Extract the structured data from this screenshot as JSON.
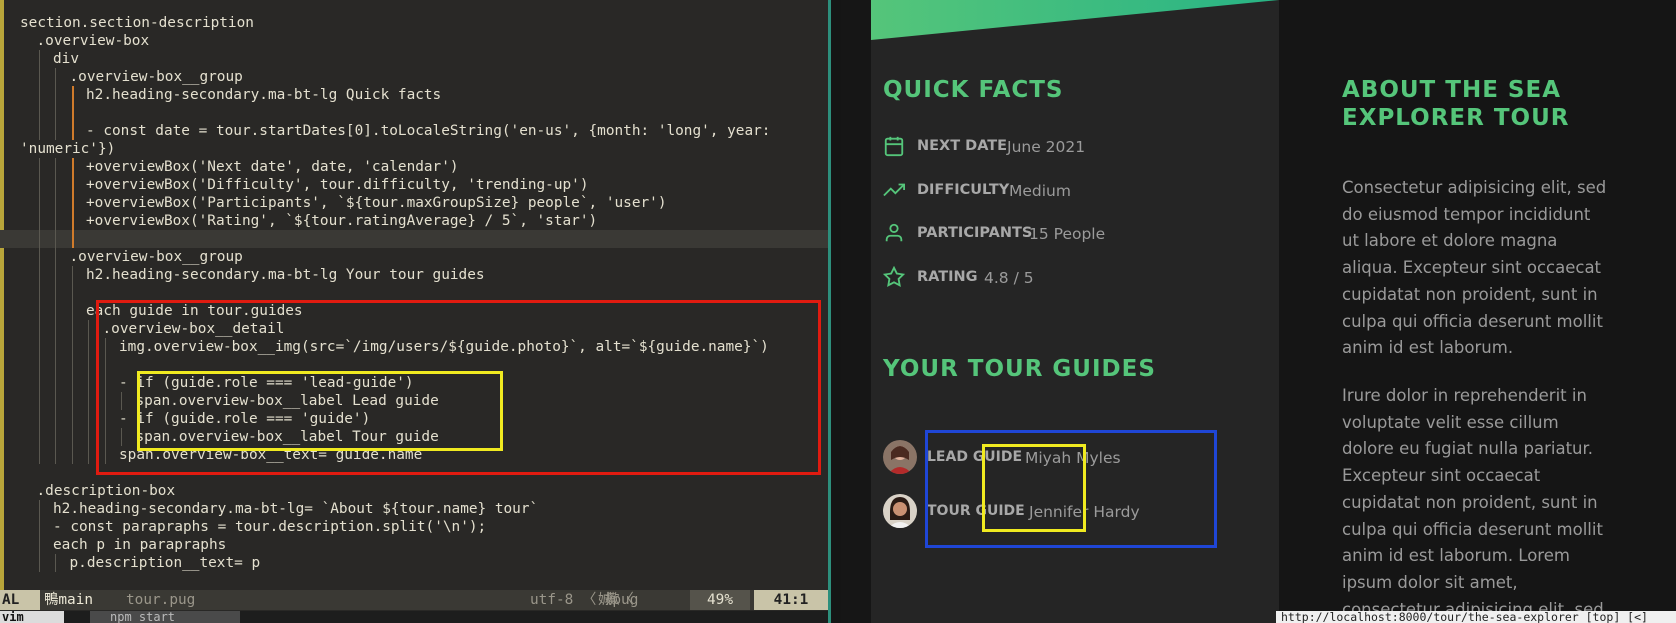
{
  "editor": {
    "lines": [
      {
        "indent": 0,
        "text": "section.section-description"
      },
      {
        "indent": 1,
        "text": ".overview-box"
      },
      {
        "indent": 2,
        "text": "div"
      },
      {
        "indent": 3,
        "text": ".overview-box__group"
      },
      {
        "indent": 4,
        "text": "h2.heading-secondary.ma-bt-lg Quick facts"
      },
      {
        "indent": 4,
        "text": ""
      },
      {
        "indent": 4,
        "text": "- const date = tour.startDates[0].toLocaleString('en-us', {month: 'long', year:"
      },
      {
        "indent": 0,
        "text": "'numeric'})"
      },
      {
        "indent": 4,
        "text": "+overviewBox('Next date', date, 'calendar')"
      },
      {
        "indent": 4,
        "text": "+overviewBox('Difficulty', tour.difficulty, 'trending-up')"
      },
      {
        "indent": 4,
        "text": "+overviewBox('Participants', `${tour.maxGroupSize} people`, 'user')"
      },
      {
        "indent": 4,
        "text": "+overviewBox('Rating', `${tour.ratingAverage} / 5`, 'star')"
      },
      {
        "indent": 4,
        "text": ""
      },
      {
        "indent": 3,
        "text": ".overview-box__group"
      },
      {
        "indent": 4,
        "text": "h2.heading-secondary.ma-bt-lg Your tour guides"
      },
      {
        "indent": 4,
        "text": ""
      },
      {
        "indent": 4,
        "text": "each guide in tour.guides"
      },
      {
        "indent": 5,
        "text": ".overview-box__detail"
      },
      {
        "indent": 6,
        "text": "img.overview-box__img(src=`/img/users/${guide.photo}`, alt=`${guide.name}`)"
      },
      {
        "indent": 6,
        "text": ""
      },
      {
        "indent": 6,
        "text": "- if (guide.role === 'lead-guide')"
      },
      {
        "indent": 7,
        "text": "span.overview-box__label Lead guide"
      },
      {
        "indent": 6,
        "text": "- if (guide.role === 'guide')"
      },
      {
        "indent": 7,
        "text": "span.overview-box__label Tour guide"
      },
      {
        "indent": 6,
        "text": "span.overview-box__text= guide.name"
      },
      {
        "indent": 0,
        "text": ""
      },
      {
        "indent": 1,
        "text": ".description-box"
      },
      {
        "indent": 2,
        "text": "h2.heading-secondary.ma-bt-lg= `About ${tour.name} tour`"
      },
      {
        "indent": 2,
        "text": "- const parapraphs = tour.description.split('\\n');"
      },
      {
        "indent": 2,
        "text": "each p in parapraphs"
      },
      {
        "indent": 3,
        "text": "p.description__text= p"
      }
    ],
    "statusline": {
      "mode": "AL",
      "branch": "鴨main",
      "file": "tour.pug",
      "encoding": "utf-8 〈 擹〈",
      "filetype": "娍pug",
      "percent": "49%",
      "position": "41:1"
    },
    "tmux": {
      "window1": "vim",
      "window2": "npm start"
    }
  },
  "page": {
    "quick_facts_title": "Quick facts",
    "facts": [
      {
        "icon": "calendar-icon",
        "label": "Next date",
        "text": "June 2021"
      },
      {
        "icon": "trending-up-icon",
        "label": "Difficulty",
        "text": "Medium"
      },
      {
        "icon": "user-icon",
        "label": "Participants",
        "text": "15 People"
      },
      {
        "icon": "star-icon",
        "label": "Rating",
        "text": "4.8 / 5"
      }
    ],
    "guides_title": "Your tour guides",
    "guides": [
      {
        "label": "Lead guide",
        "name": "Miyah Myles"
      },
      {
        "label": "Tour guide",
        "name": "Jennifer Hardy"
      }
    ],
    "about_title_line1": "About the Sea",
    "about_title_line2": "Explorer tour",
    "paragraph1": "Consectetur adipisicing elit, sed do eiusmod tempor incididunt ut labore et dolore magna aliqua. Excepteur sint occaecat cupidatat non proident, sunt in culpa qui officia deserunt mollit anim id est laborum.",
    "paragraph2": "Irure dolor in reprehenderit in voluptate velit esse cillum dolore eu fugiat nulla pariatur. Excepteur sint occaecat cupidatat non proident, sunt in culpa qui officia deserunt mollit anim id est laborum. Lorem ipsum dolor sit amet, consectetur adipisicing elit, sed do eiusmod tempor",
    "status_url": "http://localhost:8000/tour/the-sea-explorer [top] [<]"
  },
  "colors": {
    "accent_green": "#55c57a",
    "annotation_red": "#e01b10",
    "annotation_yellow": "#f0ea20",
    "annotation_blue": "#1f46d6"
  }
}
